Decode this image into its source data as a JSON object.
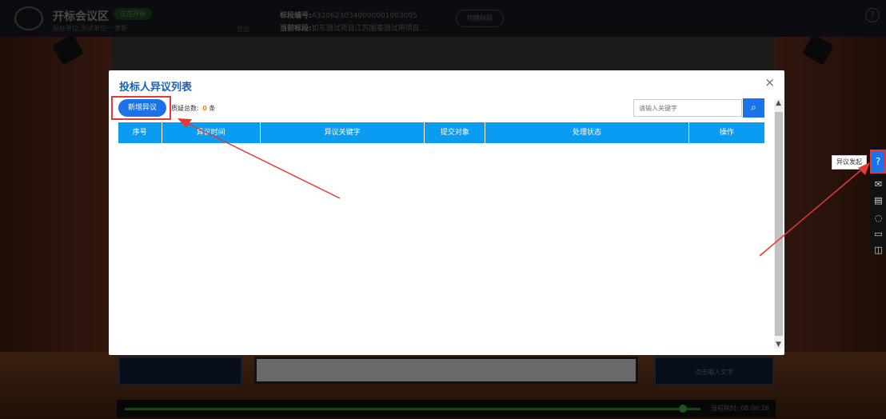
{
  "header": {
    "title": "开标会议区",
    "status_badge": "正在开标",
    "unit": "投标单位:测试单位一 李斯",
    "logout": "登出",
    "bid_no_label": "标段编号:",
    "bid_no_value": "A3206230340000001003005",
    "bid_section_label": "当前标段:",
    "bid_section_value": "如东测试项目江苏国泰测试用项目...",
    "switch_label": "切换标段",
    "help_icon": "?"
  },
  "modal": {
    "title": "投标人异议列表",
    "add_button": "新增异议",
    "total_label": "质疑总数:",
    "total_count": "0",
    "total_unit": "条",
    "search_placeholder": "请输入关键字",
    "close": "×",
    "columns": [
      "序号",
      "异议时间",
      "异议关键字",
      "提交对象",
      "处理状态",
      "操作"
    ]
  },
  "sidebar": {
    "tooltip": "异议发起",
    "icons": [
      "question-icon",
      "mail-icon",
      "document-icon",
      "chat-icon",
      "message-icon",
      "book-icon"
    ]
  },
  "stage": {
    "right_screen_text": "点击输入文字",
    "timer": "当前耗时: 08:06:26"
  },
  "colors": {
    "accent": "#1a73e8",
    "table_header": "#0a9cf0",
    "highlight": "#e53935",
    "count": "#e08a00"
  }
}
